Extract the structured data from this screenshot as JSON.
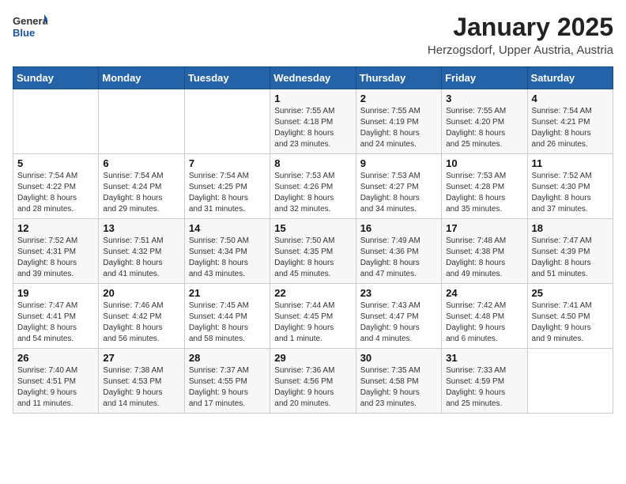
{
  "logo": {
    "general": "General",
    "blue": "Blue"
  },
  "title": "January 2025",
  "subtitle": "Herzogsdorf, Upper Austria, Austria",
  "headers": [
    "Sunday",
    "Monday",
    "Tuesday",
    "Wednesday",
    "Thursday",
    "Friday",
    "Saturday"
  ],
  "weeks": [
    [
      {
        "day": "",
        "info": ""
      },
      {
        "day": "",
        "info": ""
      },
      {
        "day": "",
        "info": ""
      },
      {
        "day": "1",
        "info": "Sunrise: 7:55 AM\nSunset: 4:18 PM\nDaylight: 8 hours\nand 23 minutes."
      },
      {
        "day": "2",
        "info": "Sunrise: 7:55 AM\nSunset: 4:19 PM\nDaylight: 8 hours\nand 24 minutes."
      },
      {
        "day": "3",
        "info": "Sunrise: 7:55 AM\nSunset: 4:20 PM\nDaylight: 8 hours\nand 25 minutes."
      },
      {
        "day": "4",
        "info": "Sunrise: 7:54 AM\nSunset: 4:21 PM\nDaylight: 8 hours\nand 26 minutes."
      }
    ],
    [
      {
        "day": "5",
        "info": "Sunrise: 7:54 AM\nSunset: 4:22 PM\nDaylight: 8 hours\nand 28 minutes."
      },
      {
        "day": "6",
        "info": "Sunrise: 7:54 AM\nSunset: 4:24 PM\nDaylight: 8 hours\nand 29 minutes."
      },
      {
        "day": "7",
        "info": "Sunrise: 7:54 AM\nSunset: 4:25 PM\nDaylight: 8 hours\nand 31 minutes."
      },
      {
        "day": "8",
        "info": "Sunrise: 7:53 AM\nSunset: 4:26 PM\nDaylight: 8 hours\nand 32 minutes."
      },
      {
        "day": "9",
        "info": "Sunrise: 7:53 AM\nSunset: 4:27 PM\nDaylight: 8 hours\nand 34 minutes."
      },
      {
        "day": "10",
        "info": "Sunrise: 7:53 AM\nSunset: 4:28 PM\nDaylight: 8 hours\nand 35 minutes."
      },
      {
        "day": "11",
        "info": "Sunrise: 7:52 AM\nSunset: 4:30 PM\nDaylight: 8 hours\nand 37 minutes."
      }
    ],
    [
      {
        "day": "12",
        "info": "Sunrise: 7:52 AM\nSunset: 4:31 PM\nDaylight: 8 hours\nand 39 minutes."
      },
      {
        "day": "13",
        "info": "Sunrise: 7:51 AM\nSunset: 4:32 PM\nDaylight: 8 hours\nand 41 minutes."
      },
      {
        "day": "14",
        "info": "Sunrise: 7:50 AM\nSunset: 4:34 PM\nDaylight: 8 hours\nand 43 minutes."
      },
      {
        "day": "15",
        "info": "Sunrise: 7:50 AM\nSunset: 4:35 PM\nDaylight: 8 hours\nand 45 minutes."
      },
      {
        "day": "16",
        "info": "Sunrise: 7:49 AM\nSunset: 4:36 PM\nDaylight: 8 hours\nand 47 minutes."
      },
      {
        "day": "17",
        "info": "Sunrise: 7:48 AM\nSunset: 4:38 PM\nDaylight: 8 hours\nand 49 minutes."
      },
      {
        "day": "18",
        "info": "Sunrise: 7:47 AM\nSunset: 4:39 PM\nDaylight: 8 hours\nand 51 minutes."
      }
    ],
    [
      {
        "day": "19",
        "info": "Sunrise: 7:47 AM\nSunset: 4:41 PM\nDaylight: 8 hours\nand 54 minutes."
      },
      {
        "day": "20",
        "info": "Sunrise: 7:46 AM\nSunset: 4:42 PM\nDaylight: 8 hours\nand 56 minutes."
      },
      {
        "day": "21",
        "info": "Sunrise: 7:45 AM\nSunset: 4:44 PM\nDaylight: 8 hours\nand 58 minutes."
      },
      {
        "day": "22",
        "info": "Sunrise: 7:44 AM\nSunset: 4:45 PM\nDaylight: 9 hours\nand 1 minute."
      },
      {
        "day": "23",
        "info": "Sunrise: 7:43 AM\nSunset: 4:47 PM\nDaylight: 9 hours\nand 4 minutes."
      },
      {
        "day": "24",
        "info": "Sunrise: 7:42 AM\nSunset: 4:48 PM\nDaylight: 9 hours\nand 6 minutes."
      },
      {
        "day": "25",
        "info": "Sunrise: 7:41 AM\nSunset: 4:50 PM\nDaylight: 9 hours\nand 9 minutes."
      }
    ],
    [
      {
        "day": "26",
        "info": "Sunrise: 7:40 AM\nSunset: 4:51 PM\nDaylight: 9 hours\nand 11 minutes."
      },
      {
        "day": "27",
        "info": "Sunrise: 7:38 AM\nSunset: 4:53 PM\nDaylight: 9 hours\nand 14 minutes."
      },
      {
        "day": "28",
        "info": "Sunrise: 7:37 AM\nSunset: 4:55 PM\nDaylight: 9 hours\nand 17 minutes."
      },
      {
        "day": "29",
        "info": "Sunrise: 7:36 AM\nSunset: 4:56 PM\nDaylight: 9 hours\nand 20 minutes."
      },
      {
        "day": "30",
        "info": "Sunrise: 7:35 AM\nSunset: 4:58 PM\nDaylight: 9 hours\nand 23 minutes."
      },
      {
        "day": "31",
        "info": "Sunrise: 7:33 AM\nSunset: 4:59 PM\nDaylight: 9 hours\nand 25 minutes."
      },
      {
        "day": "",
        "info": ""
      }
    ]
  ]
}
